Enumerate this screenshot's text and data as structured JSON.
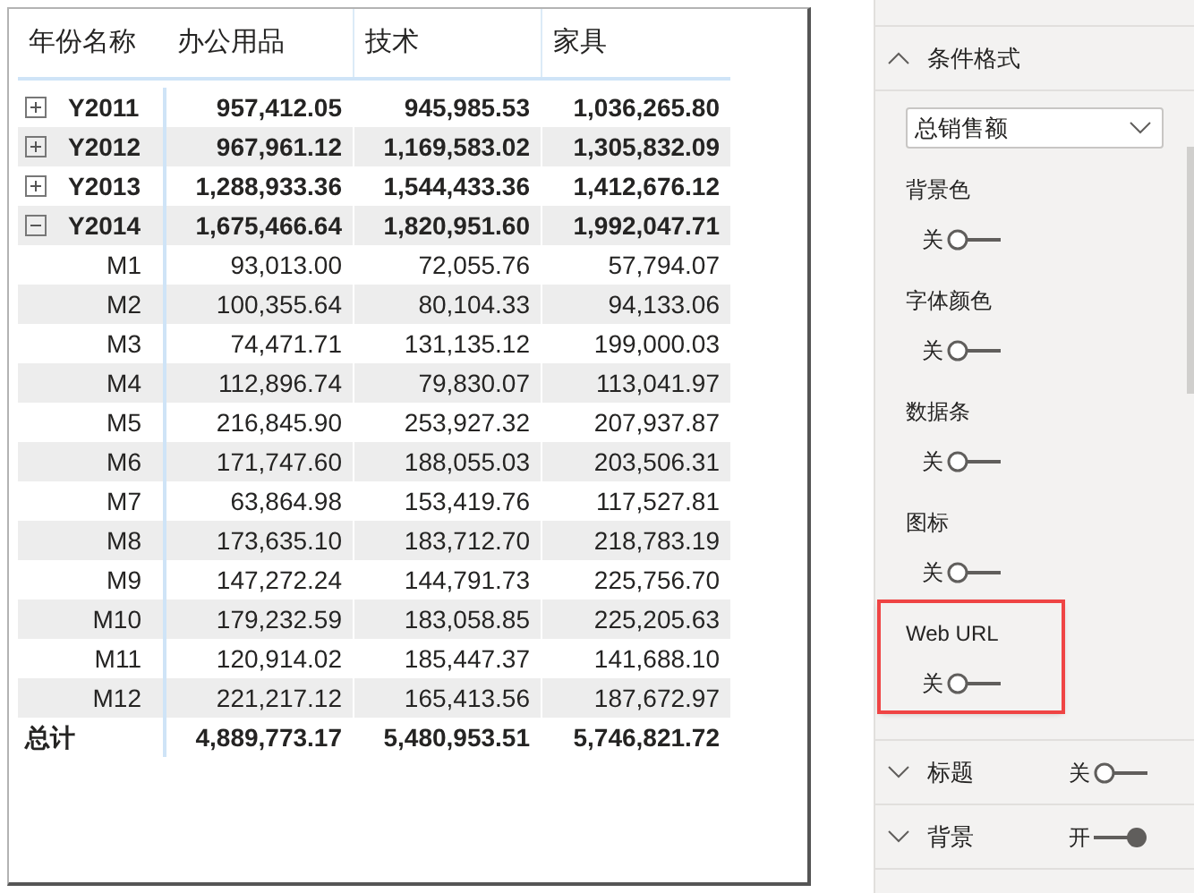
{
  "table": {
    "columns": [
      "年份名称",
      "办公用品",
      "技术",
      "家具"
    ],
    "rows": [
      {
        "label": "Y2011",
        "kind": "year",
        "expanded": false,
        "values": [
          "957,412.05",
          "945,985.53",
          "1,036,265.80"
        ]
      },
      {
        "label": "Y2012",
        "kind": "year",
        "expanded": false,
        "values": [
          "967,961.12",
          "1,169,583.02",
          "1,305,832.09"
        ]
      },
      {
        "label": "Y2013",
        "kind": "year",
        "expanded": false,
        "values": [
          "1,288,933.36",
          "1,544,433.36",
          "1,412,676.12"
        ]
      },
      {
        "label": "Y2014",
        "kind": "year",
        "expanded": true,
        "values": [
          "1,675,466.64",
          "1,820,951.60",
          "1,992,047.71"
        ],
        "children": [
          {
            "label": "M1",
            "kind": "month",
            "values": [
              "93,013.00",
              "72,055.76",
              "57,794.07"
            ]
          },
          {
            "label": "M2",
            "kind": "month",
            "values": [
              "100,355.64",
              "80,104.33",
              "94,133.06"
            ]
          },
          {
            "label": "M3",
            "kind": "month",
            "values": [
              "74,471.71",
              "131,135.12",
              "199,000.03"
            ]
          },
          {
            "label": "M4",
            "kind": "month",
            "values": [
              "112,896.74",
              "79,830.07",
              "113,041.97"
            ]
          },
          {
            "label": "M5",
            "kind": "month",
            "values": [
              "216,845.90",
              "253,927.32",
              "207,937.87"
            ]
          },
          {
            "label": "M6",
            "kind": "month",
            "values": [
              "171,747.60",
              "188,055.03",
              "203,506.31"
            ]
          },
          {
            "label": "M7",
            "kind": "month",
            "values": [
              "63,864.98",
              "153,419.76",
              "117,527.81"
            ]
          },
          {
            "label": "M8",
            "kind": "month",
            "values": [
              "173,635.10",
              "183,712.70",
              "218,783.19"
            ]
          },
          {
            "label": "M9",
            "kind": "month",
            "values": [
              "147,272.24",
              "144,791.73",
              "225,756.70"
            ]
          },
          {
            "label": "M10",
            "kind": "month",
            "values": [
              "179,232.59",
              "183,058.85",
              "225,205.63"
            ]
          },
          {
            "label": "M11",
            "kind": "month",
            "values": [
              "120,914.02",
              "185,447.37",
              "141,688.10"
            ]
          },
          {
            "label": "M12",
            "kind": "month",
            "values": [
              "221,217.12",
              "165,413.56",
              "187,672.97"
            ]
          }
        ]
      },
      {
        "label": "总计",
        "kind": "total",
        "values": [
          "4,889,773.17",
          "5,480,953.51",
          "5,746,821.72"
        ]
      }
    ]
  },
  "format_pane": {
    "conditional_formatting": {
      "title": "条件格式",
      "expanded": true,
      "field": "总销售额",
      "options": [
        {
          "label": "背景色",
          "state_label": "关",
          "on": false,
          "highlighted": false
        },
        {
          "label": "字体颜色",
          "state_label": "关",
          "on": false,
          "highlighted": false
        },
        {
          "label": "数据条",
          "state_label": "关",
          "on": false,
          "highlighted": false
        },
        {
          "label": "图标",
          "state_label": "关",
          "on": false,
          "highlighted": false
        },
        {
          "label": "Web URL",
          "state_label": "关",
          "on": false,
          "highlighted": true
        }
      ]
    },
    "sections": [
      {
        "title": "标题",
        "expanded": false,
        "state_label": "关",
        "on": false
      },
      {
        "title": "背景",
        "expanded": false,
        "state_label": "开",
        "on": true
      }
    ]
  }
}
